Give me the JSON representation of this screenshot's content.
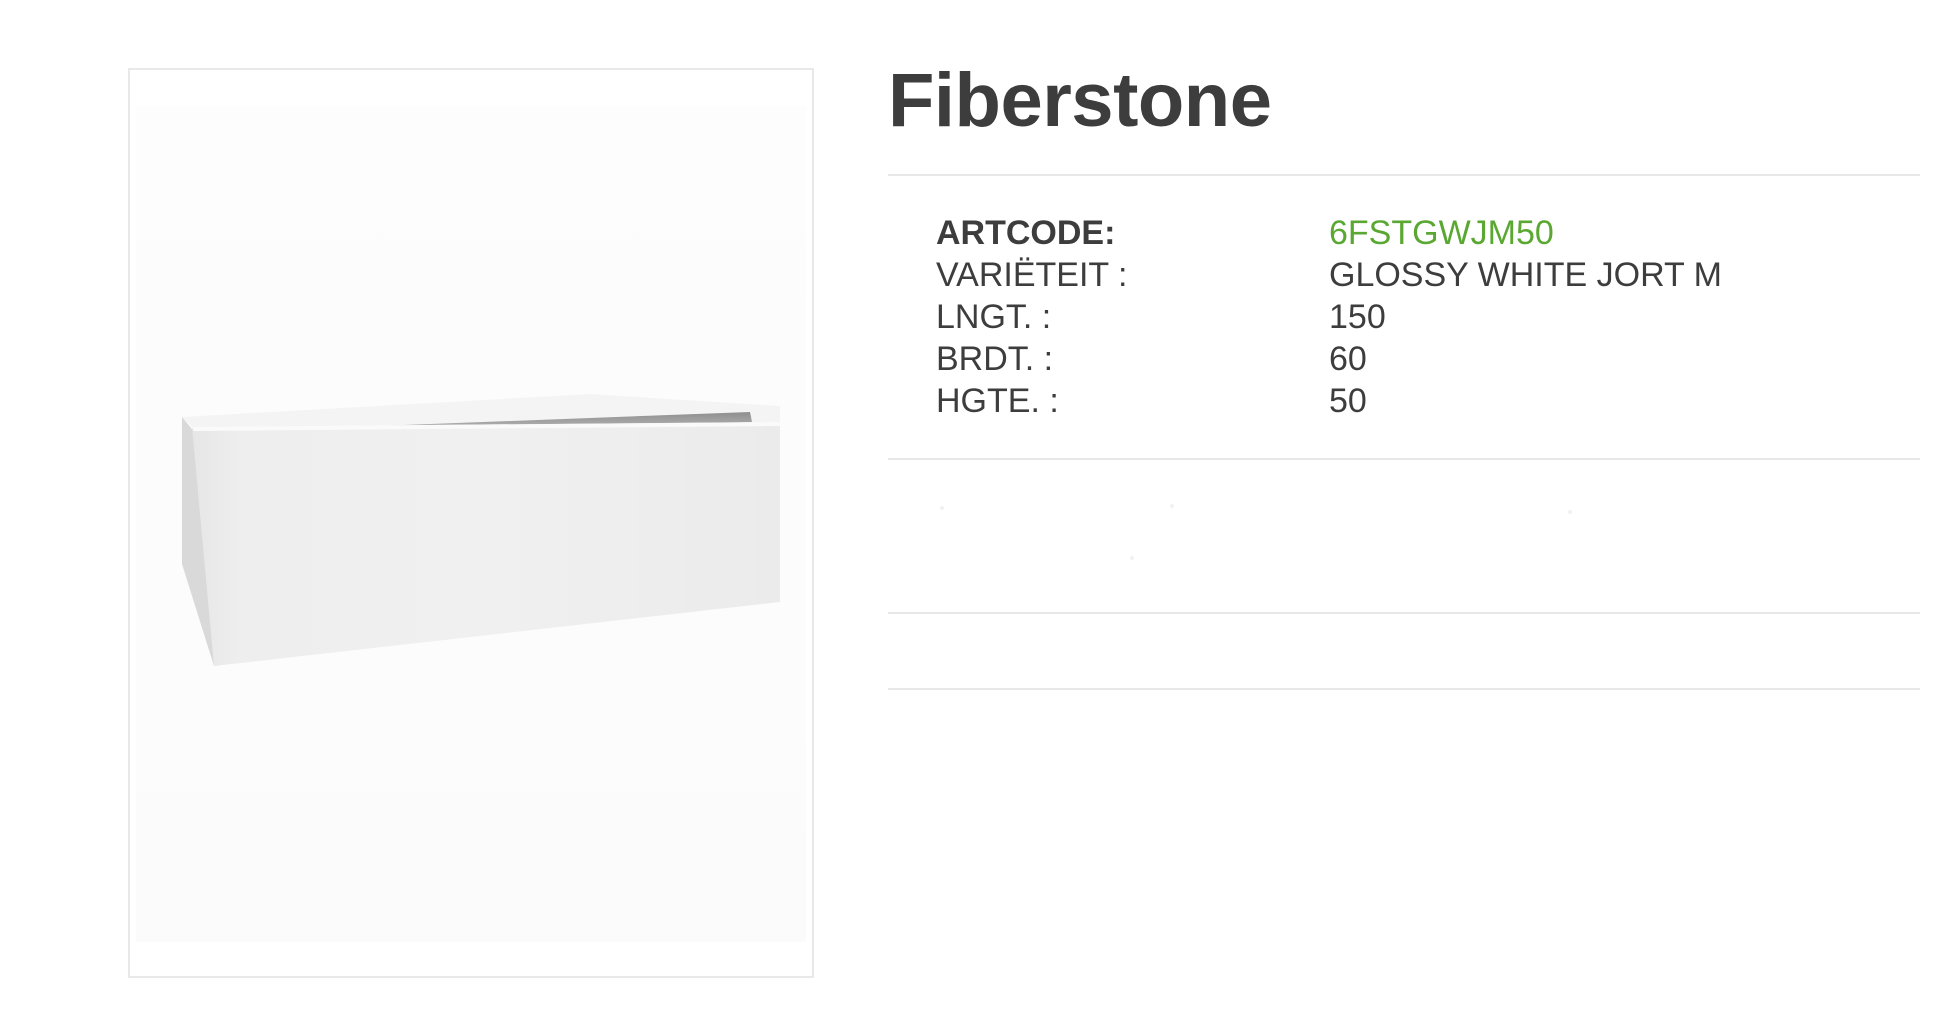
{
  "product": {
    "title": "Fiberstone",
    "image_alt": "glossy-white-rectangular-planter"
  },
  "specs": [
    {
      "label": "ARTCODE:",
      "value": "6FSTGWJM50",
      "label_bold": true,
      "value_accent": true
    },
    {
      "label": "VARIËTEIT :",
      "value": "GLOSSY WHITE JORT M"
    },
    {
      "label": "LNGT. :",
      "value": "150"
    },
    {
      "label": "BRDT. :",
      "value": "60"
    },
    {
      "label": "HGTE. :",
      "value": "50"
    }
  ],
  "colors": {
    "text": "#3d3d3d",
    "accent": "#5aa832",
    "divider": "#e8e8e8",
    "frame_border": "#e9e9e9"
  }
}
